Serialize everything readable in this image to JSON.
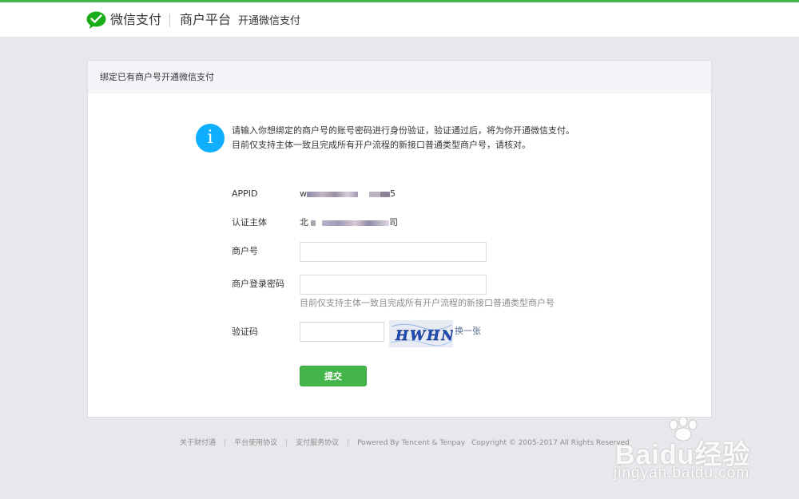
{
  "header": {
    "brand": "微信支付",
    "platform": "商户平台",
    "subtitle": "开通微信支付"
  },
  "card": {
    "title": "绑定已有商户号开通微信支付",
    "tip_line1": "请输入你想绑定的商户号的账号密码进行身份验证，验证通过后，将为你开通微信支付。",
    "tip_line2": "目前仅支持主体一致且完成所有开户流程的新接口普通类型商户号，请核对。"
  },
  "form": {
    "appid_label": "APPID",
    "appid_prefix": "w",
    "appid_suffix": "5",
    "entity_label": "认证主体",
    "entity_prefix": "北",
    "entity_suffix": "司",
    "merchant_label": "商户号",
    "merchant_value": "",
    "password_label": "商户登录密码",
    "password_value": "",
    "password_hint": "目前仅支持主体一致且完成所有开户流程的新接口普通类型商户号",
    "captcha_label": "验证码",
    "captcha_value": "",
    "captcha_text": "HWHN",
    "refresh_label": "换一张",
    "submit_label": "提交"
  },
  "footer": {
    "links": [
      "关于财付通",
      "平台使用协议",
      "支付服务协议"
    ],
    "powered": "Powered By Tencent & Tenpay",
    "copyright": "Copyright © 2005-2017 All Rights Reserved"
  },
  "watermark": {
    "brand": "Baidu经验",
    "url": "jingyan.baidu.com"
  },
  "colors": {
    "accent": "#44b549",
    "info": "#10aeff",
    "link": "#576b95"
  },
  "icons": {
    "logo": "wechat-pay-logo-icon",
    "info": "info-icon",
    "paw": "baidu-paw-icon"
  }
}
